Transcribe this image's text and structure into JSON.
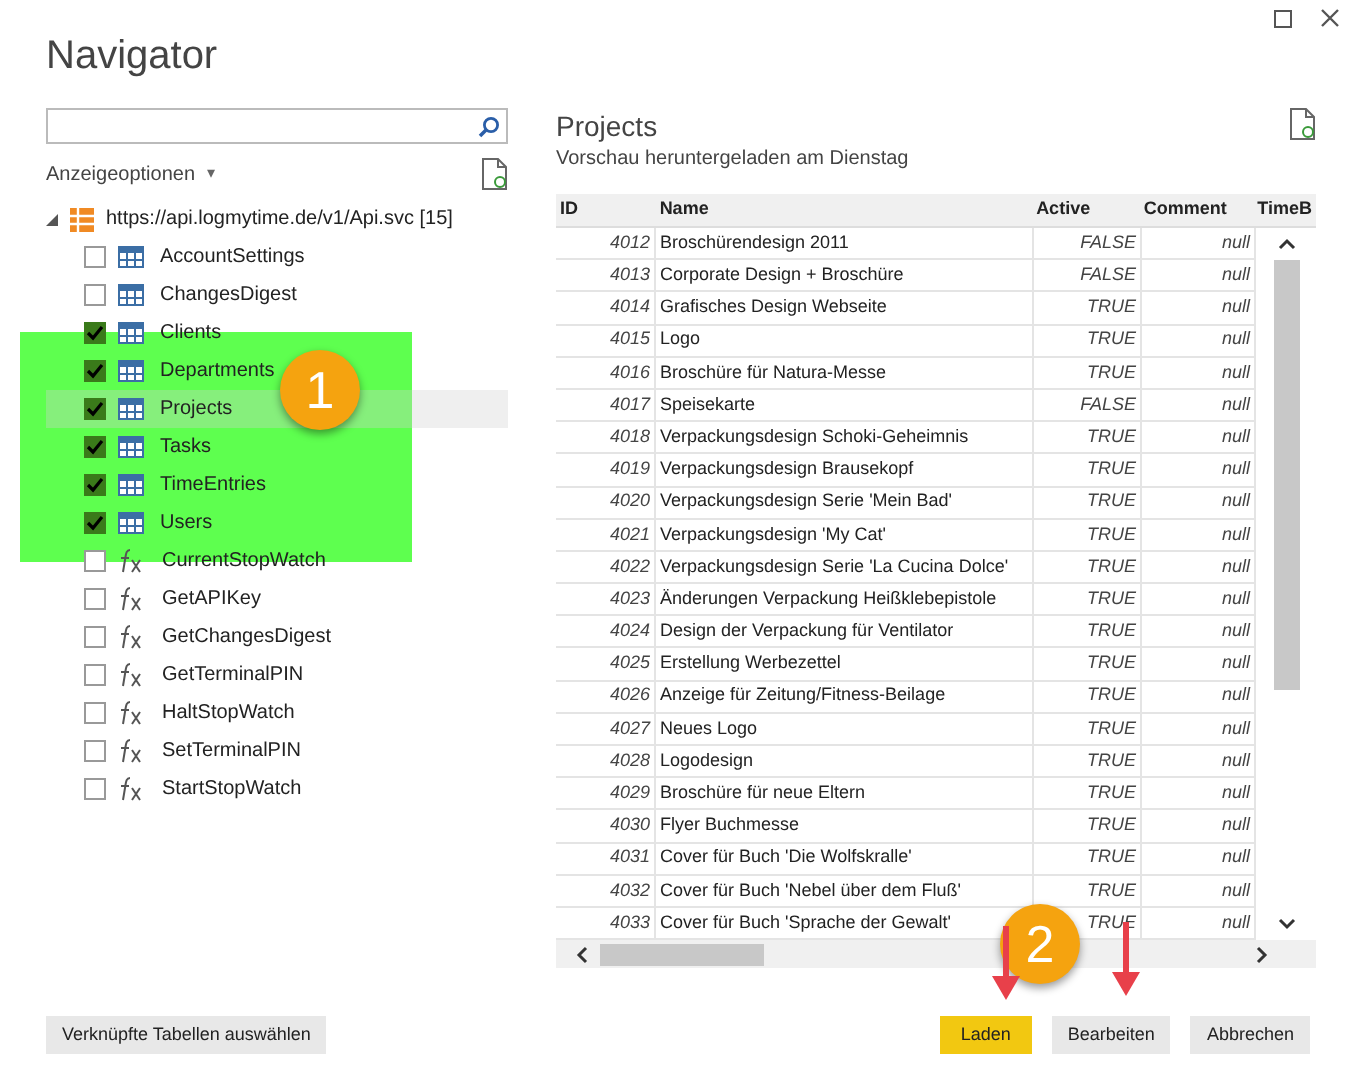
{
  "window": {
    "title": "Navigator"
  },
  "display_options": {
    "label": "Anzeigeoptionen",
    "caret": "▾"
  },
  "tree": {
    "label": "https://api.logmytime.de/v1/Api.svc [15]",
    "expanded": true,
    "children": [
      {
        "label": "AccountSettings",
        "kind": "table",
        "checked": false,
        "selected": false
      },
      {
        "label": "ChangesDigest",
        "kind": "table",
        "checked": false,
        "selected": false
      },
      {
        "label": "Clients",
        "kind": "table",
        "checked": true,
        "selected": false
      },
      {
        "label": "Departments",
        "kind": "table",
        "checked": true,
        "selected": false
      },
      {
        "label": "Projects",
        "kind": "table",
        "checked": true,
        "selected": true
      },
      {
        "label": "Tasks",
        "kind": "table",
        "checked": true,
        "selected": false
      },
      {
        "label": "TimeEntries",
        "kind": "table",
        "checked": true,
        "selected": false
      },
      {
        "label": "Users",
        "kind": "table",
        "checked": true,
        "selected": false
      },
      {
        "label": "CurrentStopWatch",
        "kind": "function",
        "checked": false,
        "selected": false
      },
      {
        "label": "GetAPIKey",
        "kind": "function",
        "checked": false,
        "selected": false
      },
      {
        "label": "GetChangesDigest",
        "kind": "function",
        "checked": false,
        "selected": false
      },
      {
        "label": "GetTerminalPIN",
        "kind": "function",
        "checked": false,
        "selected": false
      },
      {
        "label": "HaltStopWatch",
        "kind": "function",
        "checked": false,
        "selected": false
      },
      {
        "label": "SetTerminalPIN",
        "kind": "function",
        "checked": false,
        "selected": false
      },
      {
        "label": "StartStopWatch",
        "kind": "function",
        "checked": false,
        "selected": false
      }
    ]
  },
  "preview": {
    "title": "Projects",
    "subtitle": "Vorschau heruntergeladen am Dienstag",
    "columns": [
      "ID",
      "Name",
      "Active",
      "Comment",
      "TimeB"
    ],
    "rows": [
      [
        "4012",
        "Broschürendesign 2011",
        "FALSE",
        "null"
      ],
      [
        "4013",
        "Corporate Design + Broschüre",
        "FALSE",
        "null"
      ],
      [
        "4014",
        "Grafisches Design Webseite",
        "TRUE",
        "null"
      ],
      [
        "4015",
        "Logo",
        "TRUE",
        "null"
      ],
      [
        "4016",
        "Broschüre für Natura-Messe",
        "TRUE",
        "null"
      ],
      [
        "4017",
        "Speisekarte",
        "FALSE",
        "null"
      ],
      [
        "4018",
        "Verpackungsdesign Schoki-Geheimnis",
        "TRUE",
        "null"
      ],
      [
        "4019",
        "Verpackungsdesign Brausekopf",
        "TRUE",
        "null"
      ],
      [
        "4020",
        "Verpackungsdesign Serie 'Mein Bad'",
        "TRUE",
        "null"
      ],
      [
        "4021",
        "Verpackungsdesign 'My Cat'",
        "TRUE",
        "null"
      ],
      [
        "4022",
        "Verpackungsdesign Serie 'La Cucina Dolce'",
        "TRUE",
        "null"
      ],
      [
        "4023",
        "Änderungen Verpackung Heißklebepistole",
        "TRUE",
        "null"
      ],
      [
        "4024",
        "Design der Verpackung für Ventilator",
        "TRUE",
        "null"
      ],
      [
        "4025",
        "Erstellung Werbezettel",
        "TRUE",
        "null"
      ],
      [
        "4026",
        "Anzeige für Zeitung/Fitness-Beilage",
        "TRUE",
        "null"
      ],
      [
        "4027",
        "Neues Logo",
        "TRUE",
        "null"
      ],
      [
        "4028",
        "Logodesign",
        "TRUE",
        "null"
      ],
      [
        "4029",
        "Broschüre für neue Eltern",
        "TRUE",
        "null"
      ],
      [
        "4030",
        "Flyer Buchmesse",
        "TRUE",
        "null"
      ],
      [
        "4031",
        "Cover für Buch 'Die Wolfskralle'",
        "TRUE",
        "null"
      ],
      [
        "4032",
        "Cover für Buch 'Nebel über dem Fluß'",
        "TRUE",
        "null"
      ],
      [
        "4033",
        "Cover für Buch 'Sprache der Gewalt'",
        "TRUE",
        "null"
      ]
    ]
  },
  "buttons": [
    {
      "label": "Verknüpfte Tabellen auswählen",
      "kind": "secondary"
    },
    {
      "label": "Laden",
      "kind": "primary"
    },
    {
      "label": "Bearbeiten",
      "kind": "secondary"
    },
    {
      "label": "Abbrechen",
      "kind": "secondary"
    }
  ],
  "callouts": [
    {
      "label": "1"
    },
    {
      "label": "2"
    }
  ]
}
